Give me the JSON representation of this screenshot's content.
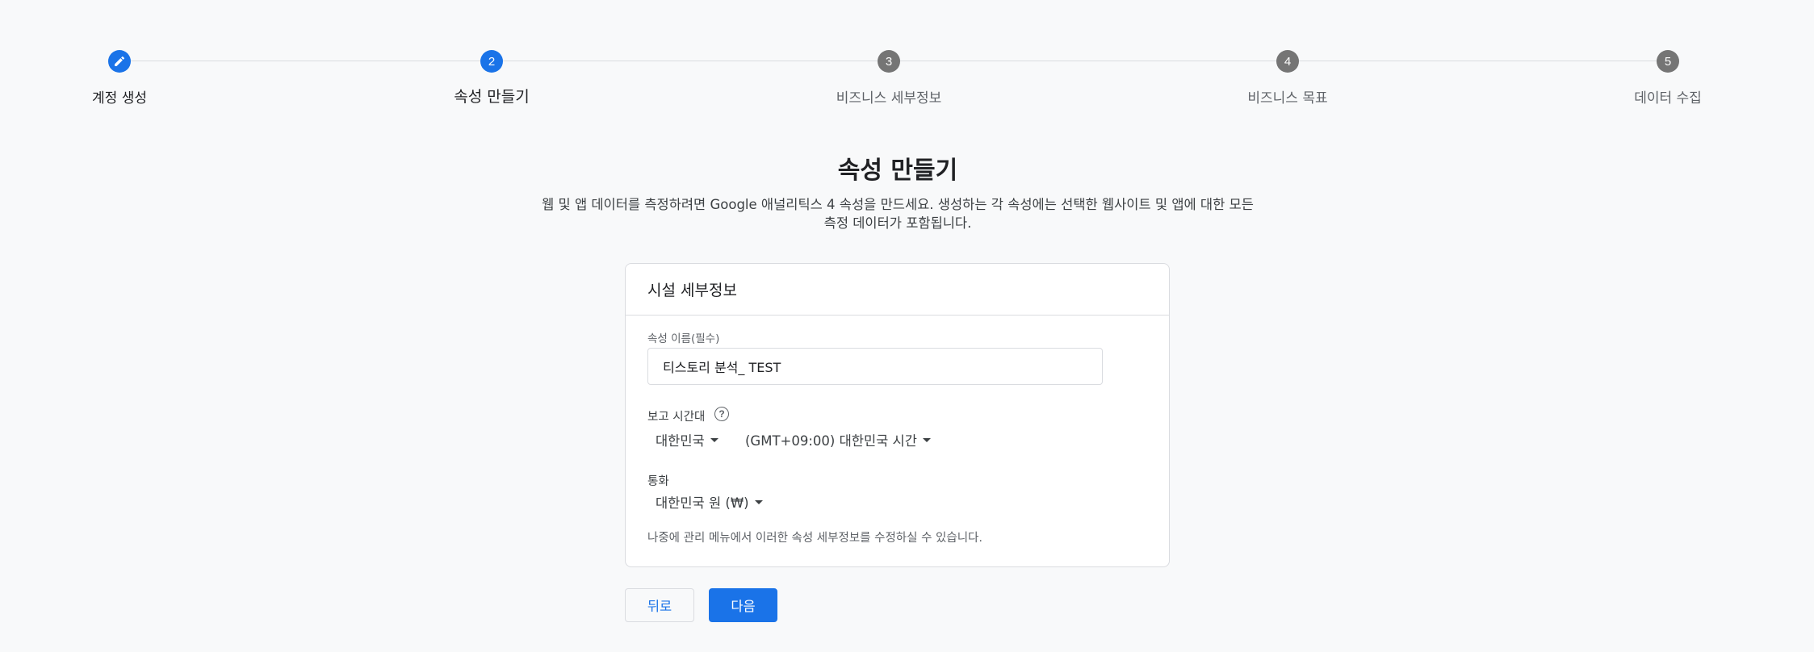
{
  "stepper": {
    "steps": [
      {
        "number": "",
        "label": "계정 생성",
        "state": "done",
        "icon": "pencil-icon"
      },
      {
        "number": "2",
        "label": "속성 만들기",
        "state": "current"
      },
      {
        "number": "3",
        "label": "비즈니스 세부정보",
        "state": "upcoming"
      },
      {
        "number": "4",
        "label": "비즈니스 목표",
        "state": "upcoming"
      },
      {
        "number": "5",
        "label": "데이터 수집",
        "state": "upcoming"
      }
    ]
  },
  "page": {
    "title": "속성 만들기",
    "description_line1": "웹 및 앱 데이터를 측정하려면 Google 애널리틱스 4 속성을 만드세요. 생성하는 각 속성에는 선택한 웹사이트 및 앱에 대한 모든",
    "description_line2": "측정 데이터가 포함됩니다."
  },
  "card": {
    "header": "시설 세부정보",
    "property_name_label": "속성 이름(필수)",
    "property_name_value": "티스토리 분석_ TEST",
    "timezone_label": "보고 시간대",
    "timezone_help_icon": "help-circle-icon",
    "country_value": "대한민국",
    "timezone_value": "(GMT+09:00) 대한민국 시간",
    "currency_label": "통화",
    "currency_value": "대한민국 원 (₩)",
    "note": "나중에 관리 메뉴에서 이러한 속성 세부정보를 수정하실 수 있습니다."
  },
  "buttons": {
    "back": "뒤로",
    "next": "다음"
  },
  "colors": {
    "accent": "#1a73e8",
    "inactive_step": "#757575",
    "background": "#f8f9fa"
  }
}
